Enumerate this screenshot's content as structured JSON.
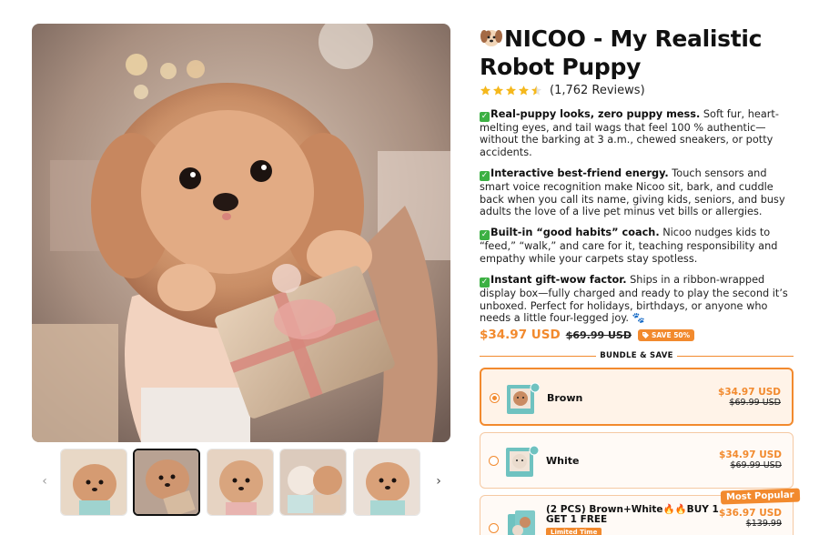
{
  "product": {
    "title_emoji_icon": "puppy-face-icon",
    "title": "NICOO - My Realistic Robot Puppy",
    "rating": 4.5,
    "review_count": "(1,762 Reviews)"
  },
  "features": [
    {
      "bold": "Real-puppy looks, zero puppy mess.",
      "text": " Soft fur, heart-melting eyes, and tail wags that feel 100 % authentic—without the barking at 3 a.m., chewed sneakers, or potty accidents."
    },
    {
      "bold": "Interactive best-friend energy.",
      "text": " Touch sensors and smart voice recognition make Nicoo sit, bark, and cuddle back when you call its name, giving kids, seniors, and busy adults the love of a live pet minus vet bills or allergies."
    },
    {
      "bold": "Built-in “good habits” coach.",
      "text": " Nicoo nudges kids to “feed,” “walk,” and care for it, teaching responsibility and empathy while your carpets stay spotless."
    },
    {
      "bold": "Instant gift-wow factor.",
      "text": " Ships in a ribbon-wrapped display box—fully charged and ready to play the second it’s unboxed. Perfect for holidays, birthdays, or anyone who needs a little four-legged joy. 🐾"
    }
  ],
  "price": {
    "current": "$34.97 USD",
    "compare_at": "$69.99 USD",
    "save_badge": "SAVE 50%"
  },
  "bundle": {
    "heading": "BUNDLE & SAVE",
    "options": [
      {
        "name": "Brown",
        "price": "$34.97 USD",
        "compare_at": "$69.99 USD",
        "selected": true
      },
      {
        "name": "White",
        "price": "$34.97 USD",
        "compare_at": "$69.99 USD",
        "selected": false
      },
      {
        "name": "(2 PCS) Brown+White🔥🔥BUY 1 GET 1 FREE",
        "price": "$36.97 USD",
        "compare_at": "$139.99",
        "badge": "Limited Time",
        "ribbon": "Most Popular",
        "selected": false
      }
    ]
  },
  "gallery": {
    "thumbnail_count": 5,
    "active_thumbnail": 2
  },
  "colors": {
    "accent": "#f28a2e",
    "check": "#3cb043",
    "star": "#f5b81c"
  }
}
